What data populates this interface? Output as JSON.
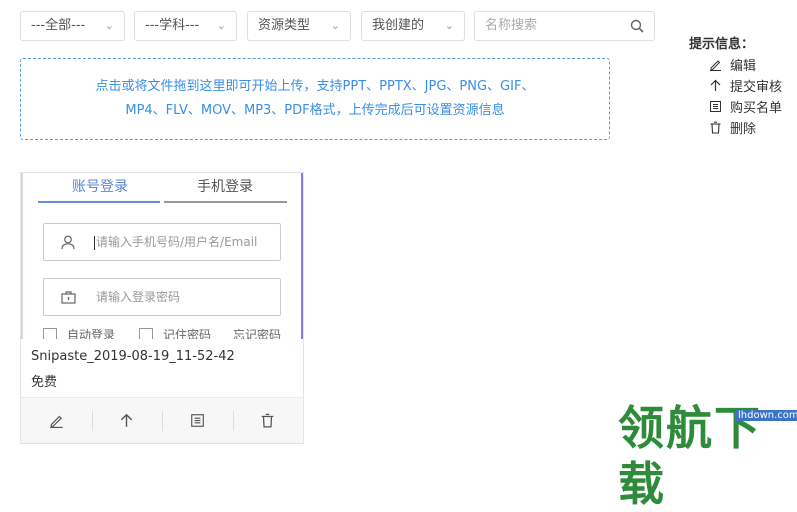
{
  "filters": {
    "all": "---全部---",
    "subject": "---学科---",
    "resource_type": "资源类型",
    "mine": "我创建的"
  },
  "search": {
    "placeholder": "名称搜索"
  },
  "upload": {
    "line1": "点击或将文件拖到这里即可开始上传，支持PPT、PPTX、JPG、PNG、GIF、",
    "line2": "MP4、FLV、MOV、MP3、PDF格式，上传完成后可设置资源信息"
  },
  "hint": {
    "title": "提示信息：",
    "items": [
      {
        "icon": "edit-icon",
        "label": "编辑"
      },
      {
        "icon": "arrow-up-icon",
        "label": "提交审核"
      },
      {
        "icon": "list-icon",
        "label": "购买名单"
      },
      {
        "icon": "trash-icon",
        "label": "删除"
      }
    ]
  },
  "card": {
    "thumb": {
      "tab_account": "账号登录",
      "tab_phone": "手机登录",
      "username_placeholder": "请输入手机号码/用户名/Email",
      "password_placeholder": "请输入登录密码",
      "cb_auto": "自动登录",
      "cb_remember": "记住密码",
      "forgot": "忘记密码"
    },
    "filename": "Snipaste_2019-08-19_11-52-42",
    "price": "免费"
  },
  "watermark": {
    "text": "领航下载",
    "url": "lhdown.com"
  },
  "colors": {
    "accent": "#3a8ee6",
    "tab_active": "#6a8fd8",
    "watermark": "#2e8b3a"
  }
}
